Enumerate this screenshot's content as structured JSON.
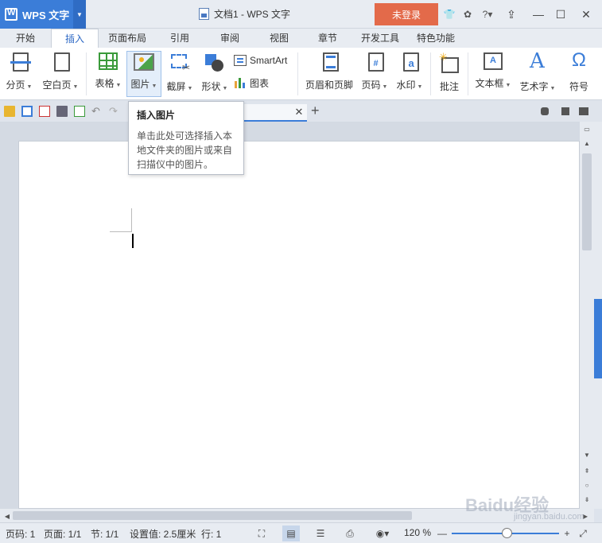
{
  "app": {
    "name": "WPS 文字",
    "window_title": "文档1 - WPS 文字",
    "login_label": "未登录"
  },
  "menu_tabs": [
    "开始",
    "插入",
    "页面布局",
    "引用",
    "审阅",
    "视图",
    "章节",
    "开发工具",
    "特色功能"
  ],
  "active_tab": "插入",
  "ribbon": {
    "page_break": "分页",
    "blank_page": "空白页",
    "table": "表格",
    "picture": "图片",
    "screenshot": "截屏",
    "shape": "形状",
    "smartart": "SmartArt",
    "chart": "图表",
    "header_footer": "页眉和页脚",
    "page_number": "页码",
    "watermark": "水印",
    "comment": "批注",
    "text_box": "文本框",
    "word_art": "艺术字",
    "symbol": "符号"
  },
  "tooltip": {
    "title": "插入图片",
    "body": "单击此处可选择插入本地文件夹的图片或来自扫描仪中的图片。"
  },
  "status": {
    "page": "页码: 1",
    "pages": "页面: 1/1",
    "section": "节: 1/1",
    "setting": "设置值: 2.5厘米",
    "line": "行: 1",
    "zoom": "120 %"
  },
  "watermark_text": {
    "brand": "Baidu经验",
    "url": "jingyan.baidu.com"
  },
  "colors": {
    "accent": "#3b7dd8",
    "login": "#e36a4a"
  }
}
